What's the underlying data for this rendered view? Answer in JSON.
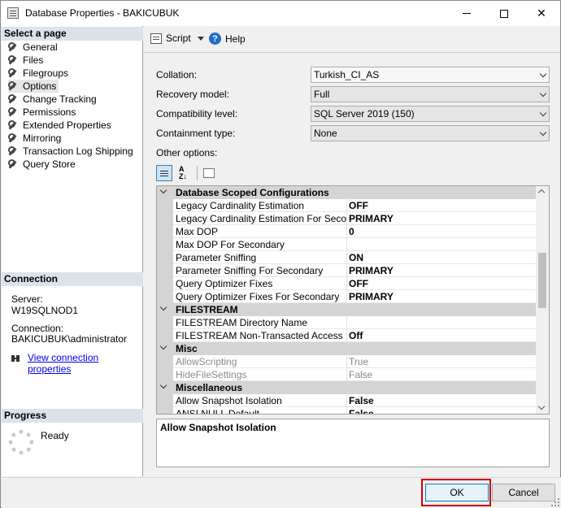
{
  "window": {
    "title": "Database Properties - BAKICUBUK"
  },
  "left": {
    "select_page_header": "Select a page",
    "items": [
      {
        "label": "General"
      },
      {
        "label": "Files"
      },
      {
        "label": "Filegroups"
      },
      {
        "label": "Options"
      },
      {
        "label": "Change Tracking"
      },
      {
        "label": "Permissions"
      },
      {
        "label": "Extended Properties"
      },
      {
        "label": "Mirroring"
      },
      {
        "label": "Transaction Log Shipping"
      },
      {
        "label": "Query Store"
      }
    ],
    "connection_header": "Connection",
    "server_label": "Server:",
    "server_value": "W19SQLNOD1",
    "connection_label": "Connection:",
    "connection_value": "BAKICUBUK\\administrator",
    "view_connection_link": "View connection properties",
    "progress_header": "Progress",
    "progress_status": "Ready"
  },
  "toolbar": {
    "script_label": "Script",
    "help_label": "Help"
  },
  "options": {
    "collation_label": "Collation:",
    "collation_value": "Turkish_CI_AS",
    "recovery_label": "Recovery model:",
    "recovery_value": "Full",
    "compat_label": "Compatibility level:",
    "compat_value": "SQL Server 2019 (150)",
    "containment_label": "Containment type:",
    "containment_value": "None",
    "other_options_label": "Other options:"
  },
  "grid": {
    "rows": [
      {
        "kind": "cat",
        "name": "Database Scoped Configurations"
      },
      {
        "kind": "prop",
        "name": "Legacy Cardinality Estimation",
        "value": "OFF"
      },
      {
        "kind": "prop",
        "name": "Legacy Cardinality Estimation For Secondary",
        "value": "PRIMARY"
      },
      {
        "kind": "prop",
        "name": "Max DOP",
        "value": "0"
      },
      {
        "kind": "prop",
        "name": "Max DOP For Secondary",
        "value": ""
      },
      {
        "kind": "prop",
        "name": "Parameter Sniffing",
        "value": "ON"
      },
      {
        "kind": "prop",
        "name": "Parameter Sniffing For Secondary",
        "value": "PRIMARY"
      },
      {
        "kind": "prop",
        "name": "Query Optimizer Fixes",
        "value": "OFF"
      },
      {
        "kind": "prop",
        "name": "Query Optimizer Fixes For Secondary",
        "value": "PRIMARY"
      },
      {
        "kind": "cat",
        "name": "FILESTREAM"
      },
      {
        "kind": "prop",
        "name": "FILESTREAM Directory Name",
        "value": ""
      },
      {
        "kind": "prop",
        "name": "FILESTREAM Non-Transacted Access",
        "value": "Off"
      },
      {
        "kind": "cat",
        "name": "Misc"
      },
      {
        "kind": "dim",
        "name": "AllowScripting",
        "value": "True"
      },
      {
        "kind": "dim",
        "name": "HideFileSettings",
        "value": "False"
      },
      {
        "kind": "cat",
        "name": "Miscellaneous"
      },
      {
        "kind": "prop",
        "name": "Allow Snapshot Isolation",
        "value": "False"
      },
      {
        "kind": "prop",
        "name": "ANSI NULL Default",
        "value": "False"
      }
    ]
  },
  "description": {
    "title": "Allow Snapshot Isolation"
  },
  "buttons": {
    "ok": "OK",
    "cancel": "Cancel"
  }
}
